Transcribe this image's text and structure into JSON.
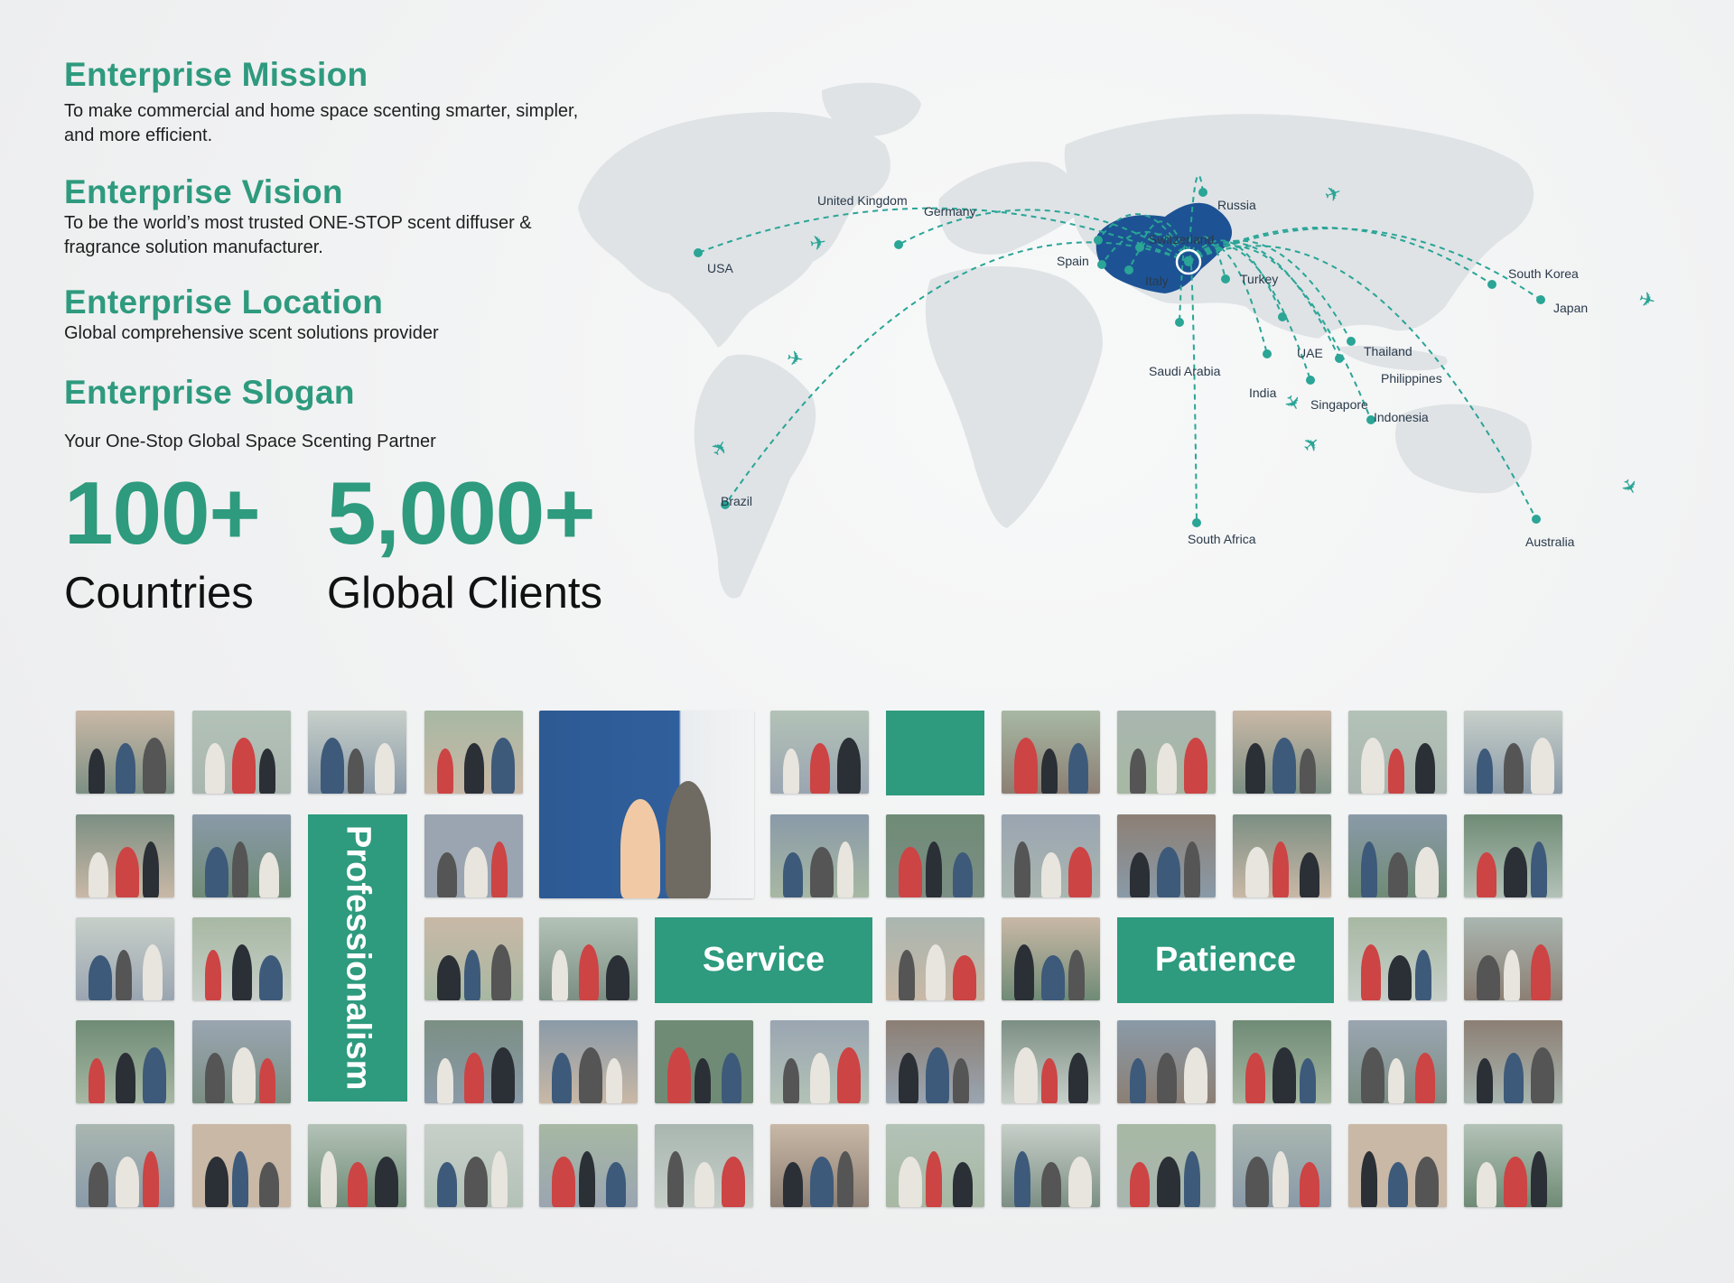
{
  "mission": {
    "title": "Enterprise Mission",
    "text_line1": "To make commercial and home space scenting smarter, simpler,",
    "text_line2": "and more efficient."
  },
  "vision": {
    "title": "Enterprise Vision",
    "text_line1": "To be the world’s most trusted ONE-STOP scent diffuser &",
    "text_line2": "fragrance solution manufacturer."
  },
  "location": {
    "title": "Enterprise  Location",
    "text": "Global comprehensive scent solutions provider"
  },
  "slogan": {
    "title": "Enterprise  Slogan",
    "text": "Your One-Stop Global Space Scenting Partner"
  },
  "stats": [
    {
      "number": "100+",
      "label": "Countries"
    },
    {
      "number": "5,000+",
      "label": "Global Clients"
    }
  ],
  "map": {
    "countries": [
      "USA",
      "United Kingdom",
      "Germany",
      "Russia",
      "Switzerland",
      "Spain",
      "Italy",
      "Turkey",
      "UAE",
      "Saudi Arabia",
      "India",
      "Singapore",
      "Thailand",
      "Philippines",
      "Indonesia",
      "South  Korea",
      "Japan",
      "Brazil",
      "South Africa",
      "Australia"
    ],
    "colors": {
      "china": "#1d5394",
      "route": "#2aa596",
      "land": "#dfe3e6"
    }
  },
  "values": {
    "professionalism": "Professionalism",
    "service": "Service",
    "patience": "Patience"
  },
  "colors": {
    "accent": "#2e9a7e",
    "text": "#1f1f1f"
  }
}
